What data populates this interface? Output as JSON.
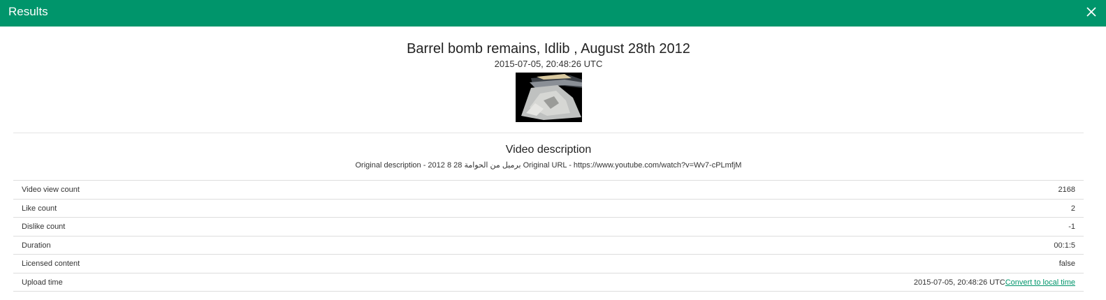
{
  "header": {
    "title": "Results",
    "close_icon": "close-icon",
    "background_color": "#00956b"
  },
  "video": {
    "title": "Barrel bomb remains, Idlib , August 28th 2012",
    "date": "2015-07-05, 20:48:26 UTC",
    "thumbnail_icon": "video-thumbnail"
  },
  "description": {
    "heading": "Video description",
    "text": "Original description - 2012 8 28 برميل من الحوامة Original URL - https://www.youtube.com/watch?v=Wv7-cPLmfjM"
  },
  "stats": [
    {
      "label": "Video view count",
      "value": "2168"
    },
    {
      "label": "Like count",
      "value": "2"
    },
    {
      "label": "Dislike count",
      "value": "-1"
    },
    {
      "label": "Duration",
      "value": "00:1:5"
    },
    {
      "label": "Licensed content",
      "value": "false"
    },
    {
      "label": "Upload time",
      "value": "2015-07-05, 20:48:26 UTC",
      "link": "Convert to local time"
    }
  ],
  "colors": {
    "accent": "#00956b",
    "divider": "#dddddd"
  }
}
